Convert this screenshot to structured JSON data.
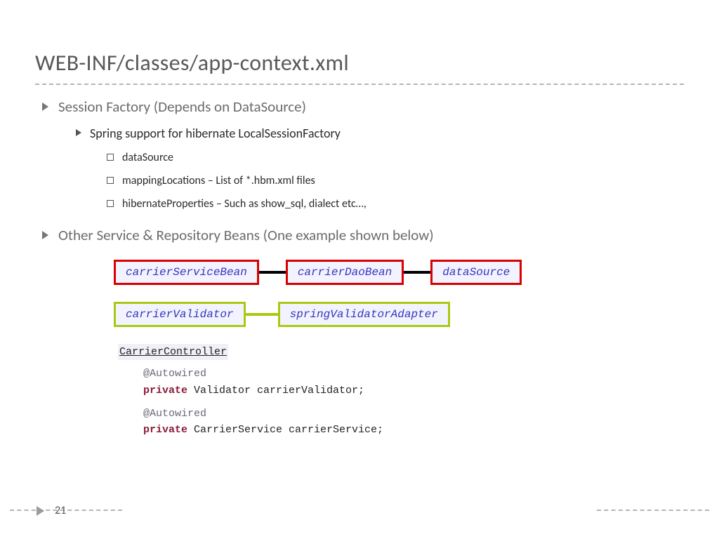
{
  "title": "WEB-INF/classes/app-context.xml",
  "bullets": {
    "l1a": "Session Factory (Depends on DataSource)",
    "l2a": "Spring support for hibernate LocalSessionFactory",
    "l3a": "dataSource",
    "l3b": "mappingLocations – List of *.hbm.xml files",
    "l3c": "hibernateProperties – Such as show_sql, dialect etc…,",
    "l1b": "Other Service & Repository Beans (One example shown below)"
  },
  "diagram": {
    "red": {
      "a": "carrierServiceBean",
      "b": "carrierDaoBean",
      "c": "dataSource"
    },
    "green": {
      "a": "carrierValidator",
      "b": "springValidatorAdapter"
    }
  },
  "code": {
    "head": "CarrierController",
    "ann1": "@Autowired",
    "kw_private": "private",
    "line1_type": " Validator carrierValidator;",
    "ann2": "@Autowired",
    "line2_type": " CarrierService carrierService;"
  },
  "pageNumber": "21"
}
